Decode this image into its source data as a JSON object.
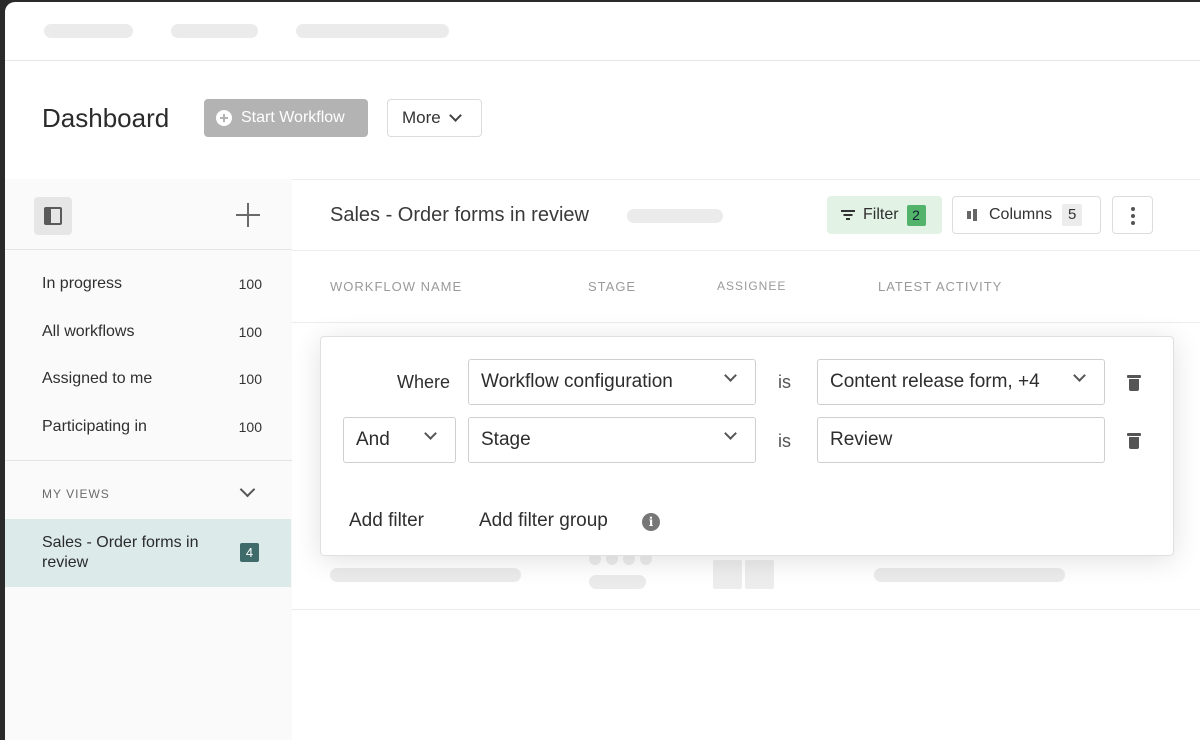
{
  "header": {
    "title": "Dashboard",
    "start_workflow_label": "Start Workflow",
    "more_label": "More"
  },
  "sidebar": {
    "items": [
      {
        "label": "In progress",
        "count": "100"
      },
      {
        "label": "All workflows",
        "count": "100"
      },
      {
        "label": "Assigned to me",
        "count": "100"
      },
      {
        "label": "Participating in",
        "count": "100"
      }
    ],
    "my_views_label": "MY VIEWS",
    "views": [
      {
        "label": "Sales - Order forms in review",
        "count": "4"
      }
    ]
  },
  "main": {
    "title": "Sales - Order forms in review",
    "filter_label": "Filter",
    "filter_count": "2",
    "columns_label": "Columns",
    "columns_count": "5",
    "table_headers": [
      "WORKFLOW NAME",
      "STAGE",
      "ASSIGNEE",
      "LATEST ACTIVITY"
    ]
  },
  "filter_panel": {
    "rows": [
      {
        "connector": "Where",
        "field": "Workflow configuration",
        "operator": "is",
        "value": "Content release form, +4"
      },
      {
        "connector": "And",
        "field": "Stage",
        "operator": "is",
        "value": "Review"
      }
    ],
    "add_filter_label": "Add filter",
    "add_filter_group_label": "Add filter group",
    "info_icon_glyph": "i"
  },
  "colors": {
    "accent_filter_bg": "#e2f3e6",
    "filter_badge": "#52b36b",
    "selected_view_bg": "#dcebea",
    "view_badge": "#3f6b6b"
  }
}
